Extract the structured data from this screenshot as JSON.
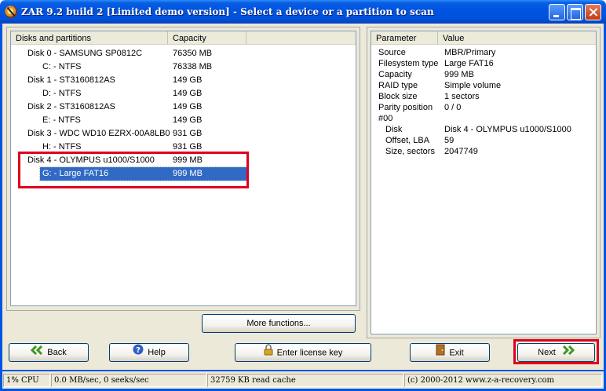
{
  "window": {
    "title": "ZAR 9.2 build 2 [Limited demo version] - Select a device or a partition to scan"
  },
  "disks_panel": {
    "columns": [
      "Disks and partitions",
      "Capacity"
    ],
    "rows": [
      {
        "name": "Disk 0 - SAMSUNG SP0812C",
        "capacity": "76350 MB",
        "indent": false
      },
      {
        "name": "C: - NTFS",
        "capacity": "76338 MB",
        "indent": true
      },
      {
        "name": "Disk 1 - ST3160812AS",
        "capacity": "149 GB",
        "indent": false
      },
      {
        "name": "D: - NTFS",
        "capacity": "149 GB",
        "indent": true
      },
      {
        "name": "Disk 2 - ST3160812AS",
        "capacity": "149 GB",
        "indent": false
      },
      {
        "name": "E: - NTFS",
        "capacity": "149 GB",
        "indent": true
      },
      {
        "name": "Disk 3 - WDC WD10 EZRX-00A8LB0",
        "capacity": "931 GB",
        "indent": false
      },
      {
        "name": "H: - NTFS",
        "capacity": "931 GB",
        "indent": true
      },
      {
        "name": "Disk 4 - OLYMPUS u1000/S1000",
        "capacity": "999 MB",
        "indent": false
      },
      {
        "name": "G: - Large FAT16",
        "capacity": "999 MB",
        "indent": true,
        "selected": true
      }
    ],
    "more_functions_label": "More functions..."
  },
  "props_panel": {
    "columns": [
      "Parameter",
      "Value"
    ],
    "rows": [
      {
        "param": "Source",
        "value": "MBR/Primary",
        "indent": false
      },
      {
        "param": "Filesystem type",
        "value": "Large FAT16",
        "indent": false
      },
      {
        "param": "Capacity",
        "value": "999 MB",
        "indent": false
      },
      {
        "param": "RAID type",
        "value": "Simple volume",
        "indent": false
      },
      {
        "param": "Block size",
        "value": "1 sectors",
        "indent": false
      },
      {
        "param": "Parity position",
        "value": "0 / 0",
        "indent": false
      },
      {
        "param": "#00",
        "value": "",
        "indent": false
      },
      {
        "param": "Disk",
        "value": "Disk 4 - OLYMPUS u1000/S1000",
        "indent": true
      },
      {
        "param": "Offset, LBA",
        "value": "59",
        "indent": true
      },
      {
        "param": "Size, sectors",
        "value": "2047749",
        "indent": true
      }
    ]
  },
  "buttons": {
    "back": "Back",
    "help": "Help",
    "license": "Enter license key",
    "exit": "Exit",
    "next": "Next"
  },
  "statusbar": {
    "cpu": "1% CPU",
    "speed": "0.0 MB/sec, 0 seeks/sec",
    "cache": "32759 KB read cache",
    "copyright": "(c) 2000-2012 www.z-a-recovery.com"
  },
  "colors": {
    "selection": "#316ac5",
    "highlight_box": "#e0001b",
    "titlebar": "#0054e3"
  }
}
